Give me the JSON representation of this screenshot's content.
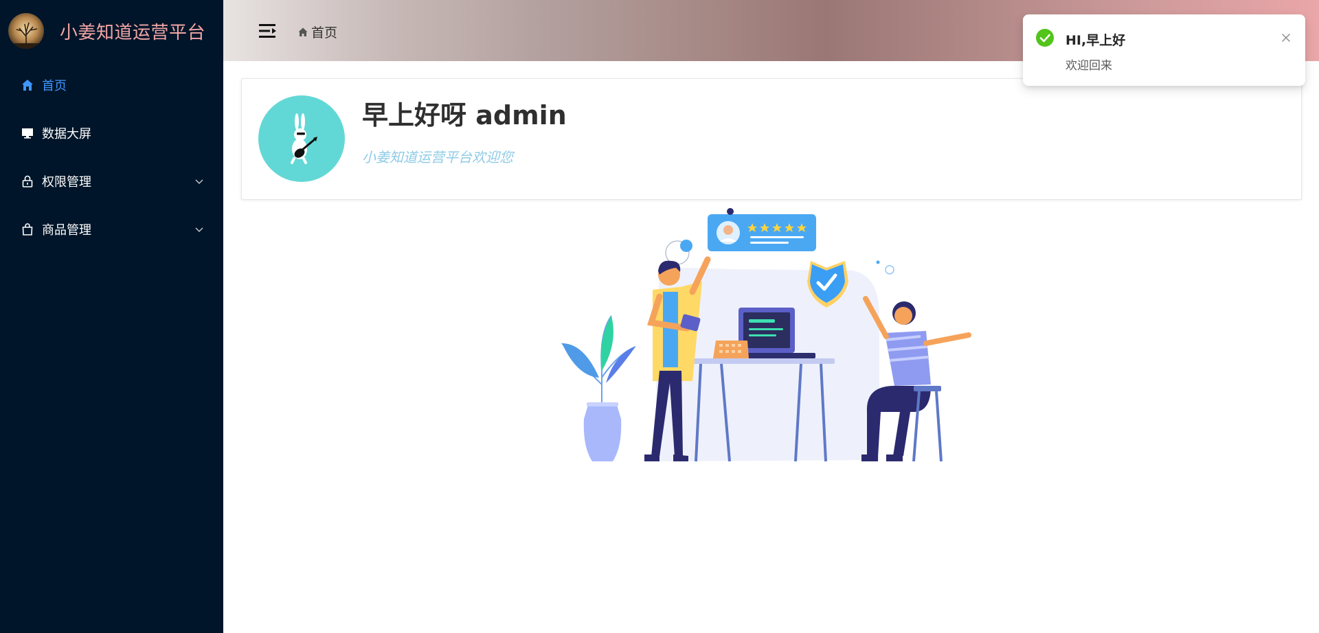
{
  "brand": {
    "title": "小姜知道运营平台"
  },
  "sidebar": {
    "items": [
      {
        "label": "首页",
        "icon": "home-icon",
        "active": true
      },
      {
        "label": "数据大屏",
        "icon": "monitor-icon"
      },
      {
        "label": "权限管理",
        "icon": "lock-icon",
        "has_submenu": true
      },
      {
        "label": "商品管理",
        "icon": "shopping-bag-icon",
        "has_submenu": true
      }
    ]
  },
  "header": {
    "breadcrumb": "首页"
  },
  "welcome": {
    "title": "早上好呀 admin",
    "subtitle": "小姜知道运营平台欢迎您"
  },
  "notification": {
    "title": "HI,早上好",
    "description": "欢迎回来"
  },
  "colors": {
    "sidebar_bg": "#001529",
    "active": "#4096ff",
    "brand_text": "#f4a6a6",
    "success": "#52c41a"
  }
}
